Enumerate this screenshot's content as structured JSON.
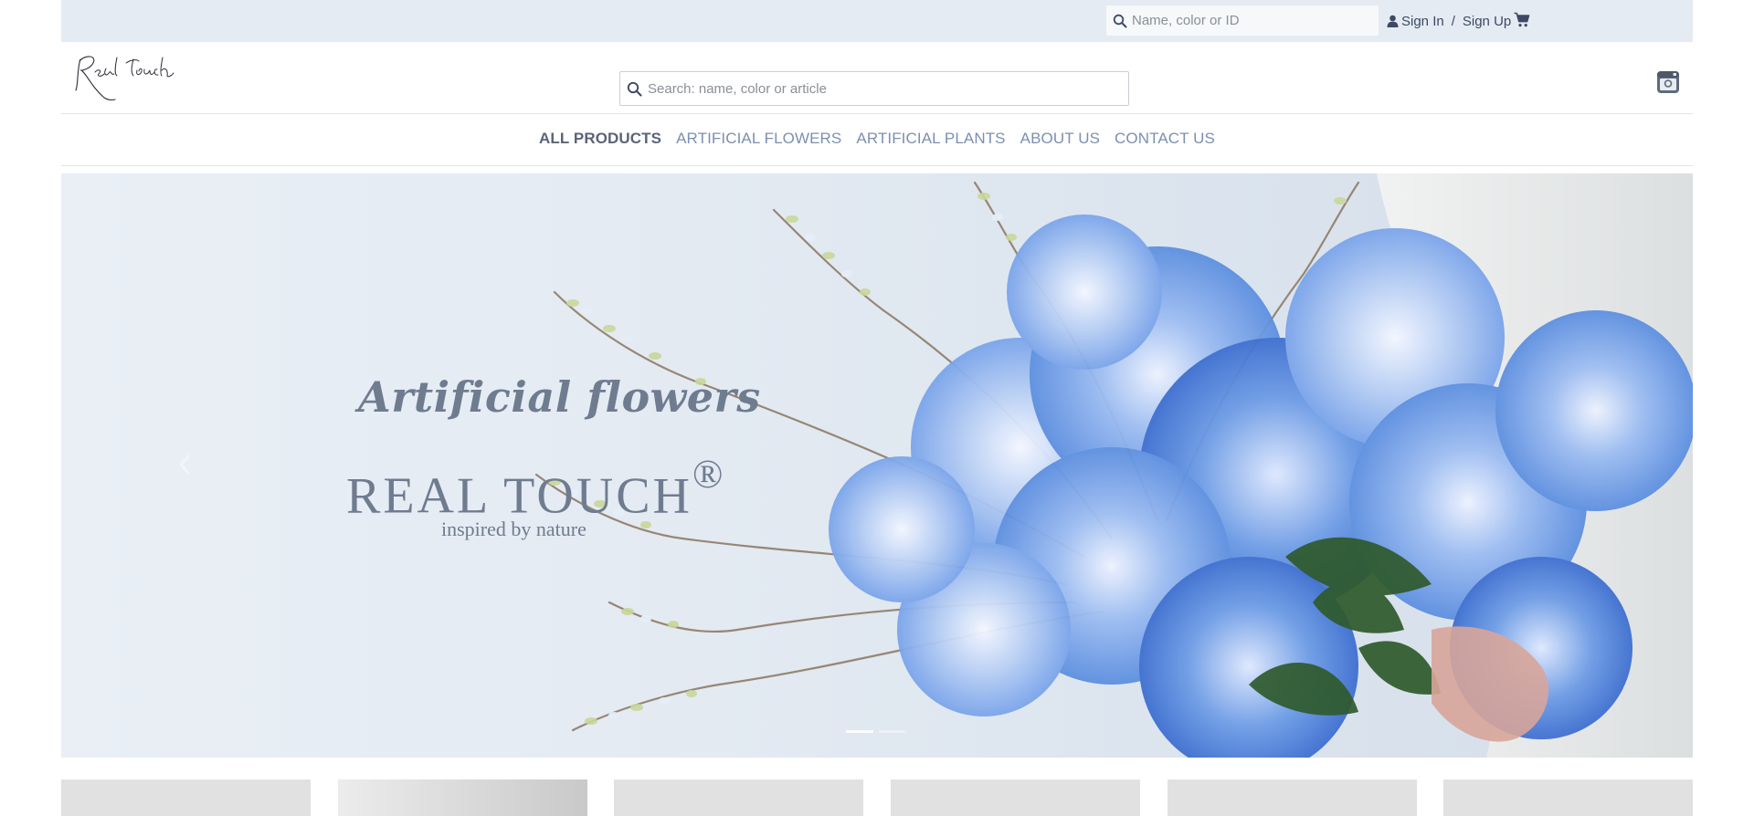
{
  "topbar": {
    "search_placeholder": "Name, color or ID",
    "sign_in": "Sign In",
    "separator": "/",
    "sign_up": "Sign Up"
  },
  "header": {
    "logo_text": "Real touch",
    "search_placeholder": "Search: name, color or article"
  },
  "nav": {
    "items": [
      {
        "label": "ALL PRODUCTS",
        "active": true
      },
      {
        "label": "ARTIFICIAL FLOWERS",
        "active": false
      },
      {
        "label": "ARTIFICIAL PLANTS",
        "active": false
      },
      {
        "label": "ABOUT US",
        "active": false
      },
      {
        "label": "CONTACT US",
        "active": false
      }
    ]
  },
  "hero": {
    "headline": "Artificial flowers",
    "brand": "REAL TOUCH",
    "registered_mark": "®",
    "tagline": "inspired by nature",
    "slides_count": 2,
    "active_slide": 0
  },
  "colors": {
    "topbar_bg": "#e4ebf3",
    "nav_link": "#7d8fb0",
    "nav_active": "#5a6478",
    "hero_text": "#6f7c90",
    "flower_blue": "#6f9de6",
    "tile_bg": "#e1e1e1"
  },
  "icons": {
    "top_search": "search-icon",
    "user": "user-icon",
    "cart": "cart-icon",
    "main_search": "search-icon",
    "instagram": "instagram-icon",
    "prev": "chevron-left-icon"
  }
}
